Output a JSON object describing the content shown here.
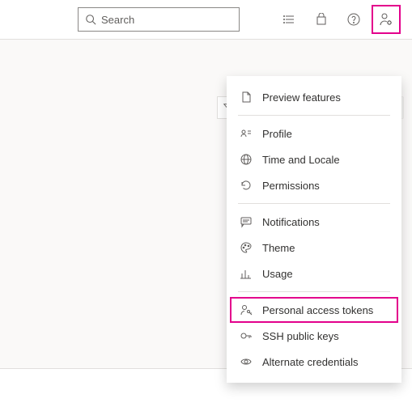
{
  "search": {
    "placeholder": "Search"
  },
  "menu": {
    "preview": "Preview features",
    "profile": "Profile",
    "time_locale": "Time and Locale",
    "permissions": "Permissions",
    "notifications": "Notifications",
    "theme": "Theme",
    "usage": "Usage",
    "pat": "Personal access tokens",
    "ssh": "SSH public keys",
    "alt_creds": "Alternate credentials"
  }
}
